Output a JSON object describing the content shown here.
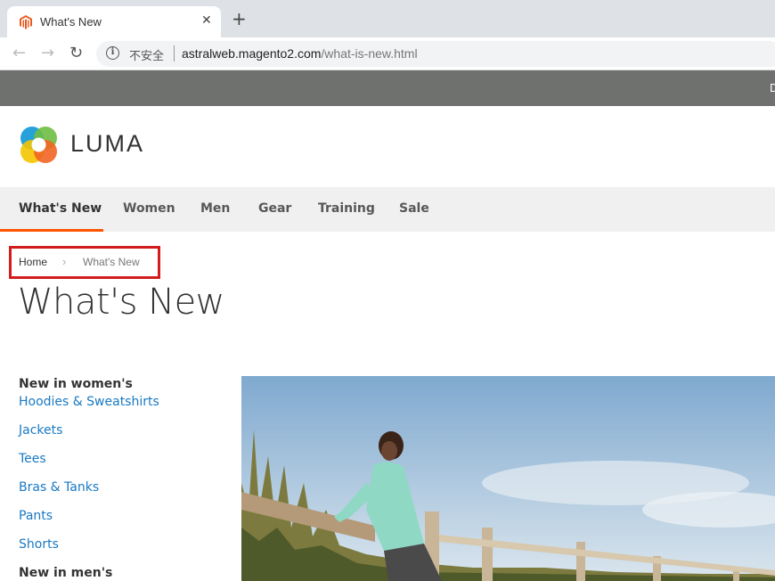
{
  "browser": {
    "tab_title": "What's New",
    "close_glyph": "✕",
    "new_tab_glyph": "+",
    "back_glyph": "←",
    "forward_glyph": "→",
    "reload_glyph": "↻",
    "security_label": "不安全",
    "url_host": "astralweb.magento2.com",
    "url_path": "/what-is-new.html"
  },
  "site": {
    "topbar_text": "D",
    "logo_text": "LUMA",
    "nav": [
      "What's New",
      "Women",
      "Men",
      "Gear",
      "Training",
      "Sale"
    ],
    "breadcrumb": {
      "home": "Home",
      "separator": "›",
      "current": "What's New"
    },
    "page_title": "What's New",
    "sidebar": {
      "women_heading": "New in women's",
      "women_links": [
        "Hoodies & Sweatshirts",
        "Jackets",
        "Tees",
        "Bras & Tanks",
        "Pants",
        "Shorts"
      ],
      "men_heading": "New in men's"
    }
  },
  "colors": {
    "accent": "#ff5501",
    "link": "#1979c3",
    "highlight_box": "#d31c1c",
    "topbar": "#6e716e"
  }
}
